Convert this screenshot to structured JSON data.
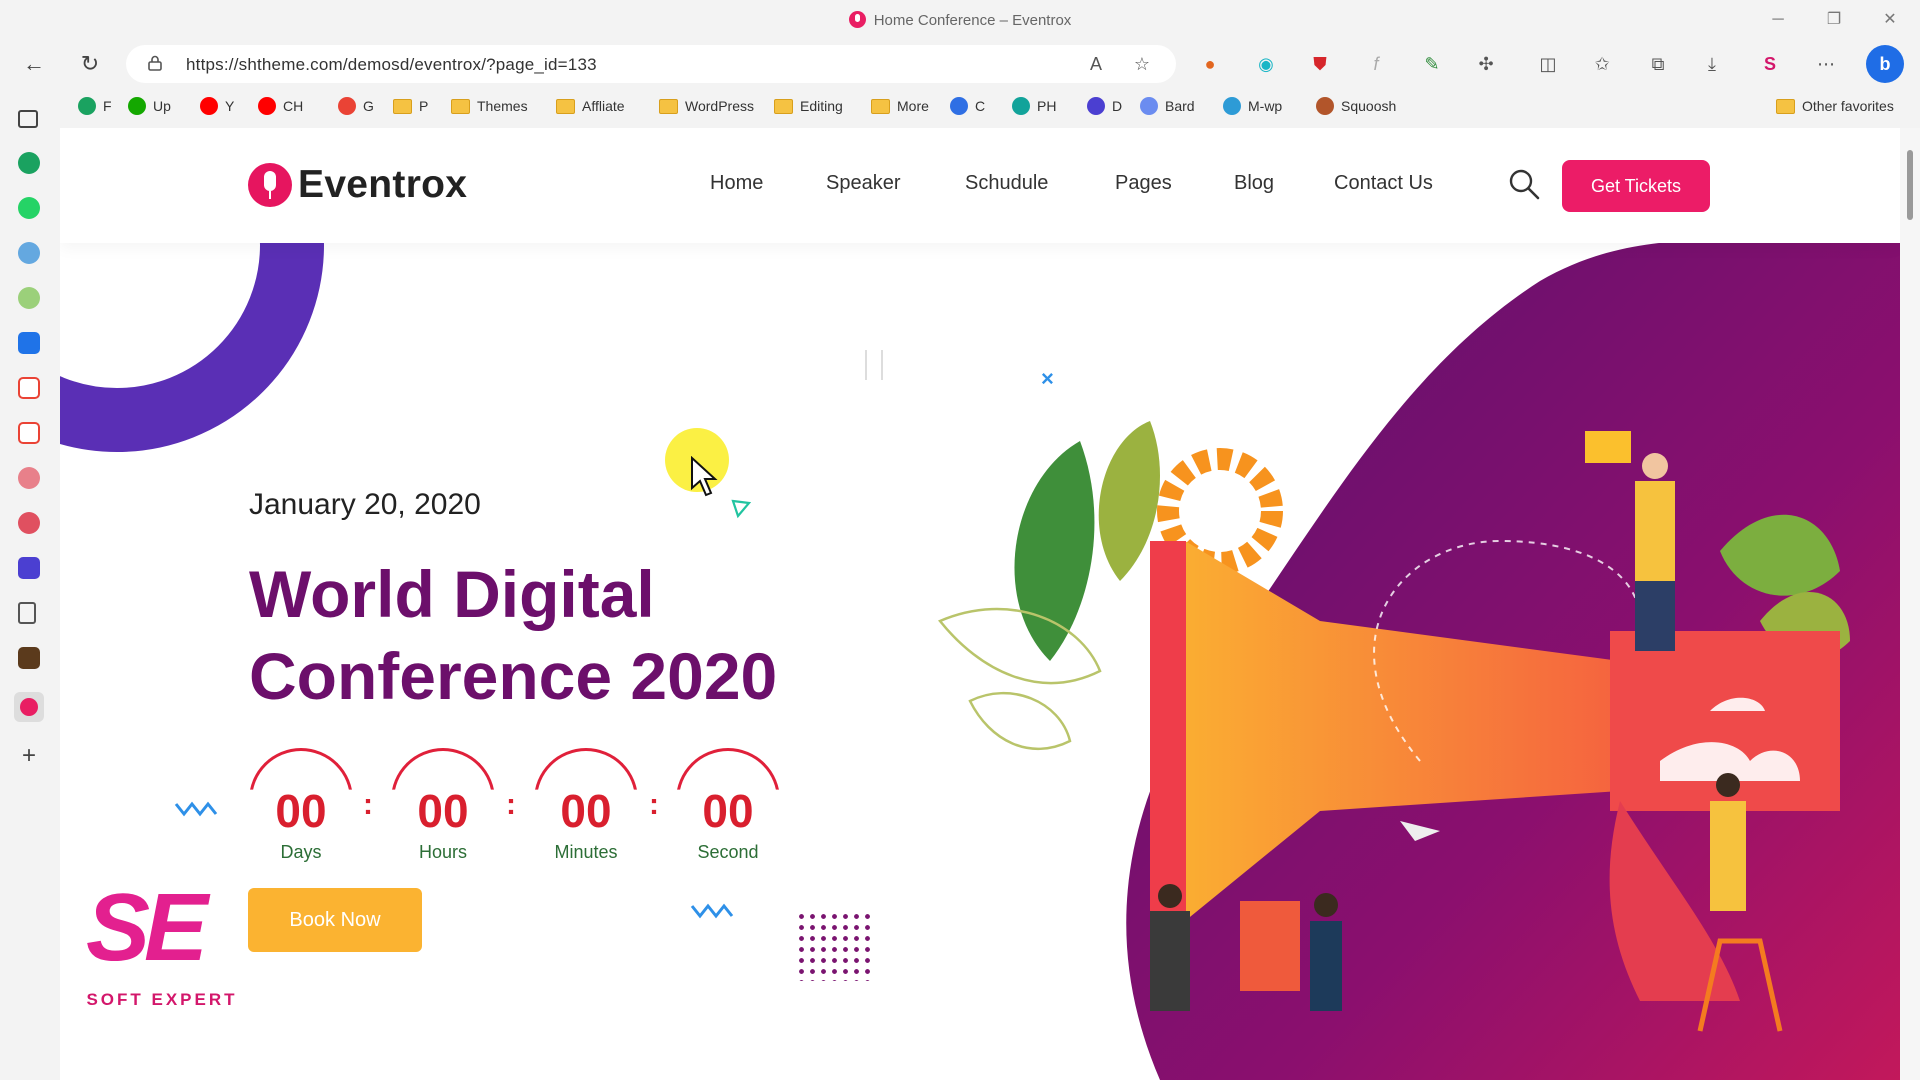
{
  "browser": {
    "window_title": "Home Conference – Eventrox",
    "url": "https://shtheme.com/demosd/eventrox/?page_id=133",
    "bookmarks": [
      {
        "label": "F",
        "color": "#1aa260"
      },
      {
        "label": "Up",
        "color": "#14a800"
      },
      {
        "label": "Y",
        "color": "#ff0000"
      },
      {
        "label": "CH",
        "color": "#ff0000"
      },
      {
        "label": "G",
        "color": "#ea4335"
      },
      {
        "label": "P",
        "folder": true
      },
      {
        "label": "Themes",
        "folder": true
      },
      {
        "label": "Affliate",
        "folder": true
      },
      {
        "label": "WordPress",
        "folder": true
      },
      {
        "label": "Editing",
        "folder": true
      },
      {
        "label": "More",
        "folder": true
      },
      {
        "label": "C",
        "color": "#2f6fe4"
      },
      {
        "label": "PH",
        "color": "#12a39a"
      },
      {
        "label": "D",
        "color": "#4b3fd1"
      },
      {
        "label": "Bard",
        "color": "#6b8cf0"
      },
      {
        "label": "M-wp",
        "color": "#2d9bd6"
      },
      {
        "label": "Squoosh",
        "color": "#b2552a"
      }
    ],
    "other_favorites": "Other favorites"
  },
  "site": {
    "brand": "Eventrox",
    "nav": [
      "Home",
      "Speaker",
      "Schudule",
      "Pages",
      "Blog",
      "Contact Us"
    ],
    "cta": "Get Tickets",
    "accent": "#ec1c67"
  },
  "hero": {
    "date": "January 20, 2020",
    "headline": "World Digital Conference 2020",
    "countdown": [
      {
        "value": "00",
        "label": "Days"
      },
      {
        "value": "00",
        "label": "Hours"
      },
      {
        "value": "00",
        "label": "Minutes"
      },
      {
        "value": "00",
        "label": "Second"
      }
    ],
    "separator": ":",
    "book_button": "Book Now",
    "headline_color": "#6c0f6b",
    "book_color": "#fbb331"
  },
  "watermark": {
    "mark": "SE",
    "text": "SOFT EXPERT"
  }
}
